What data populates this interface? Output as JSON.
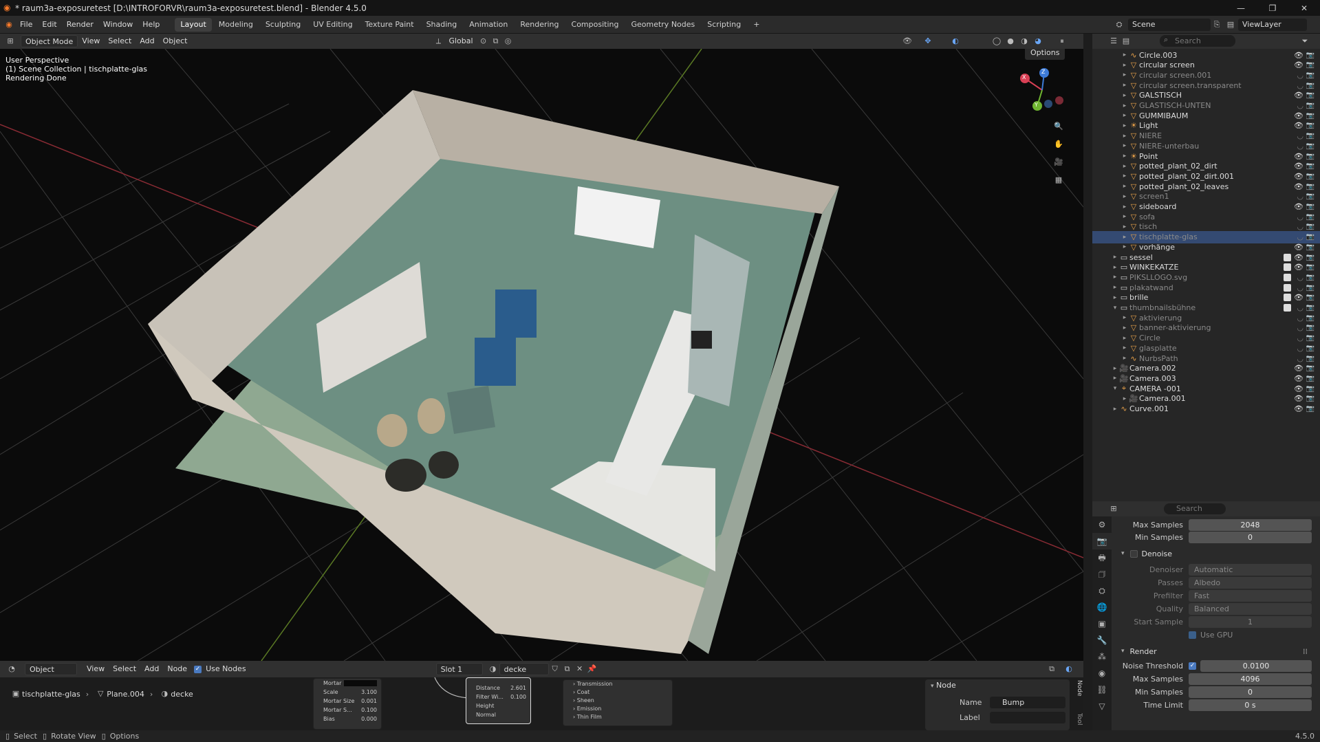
{
  "window": {
    "title": "* raum3a-exposuretest [D:\\INTROFORVR\\raum3a-exposuretest.blend] - Blender 4.5.0"
  },
  "topbar": {
    "menus": [
      "File",
      "Edit",
      "Render",
      "Window",
      "Help"
    ],
    "workspaces": [
      "Layout",
      "Modeling",
      "Sculpting",
      "UV Editing",
      "Texture Paint",
      "Shading",
      "Animation",
      "Rendering",
      "Compositing",
      "Geometry Nodes",
      "Scripting"
    ],
    "active_workspace": "Layout",
    "add_tab": "+",
    "scene": "Scene",
    "view_layer": "ViewLayer"
  },
  "viewport": {
    "mode": "Object Mode",
    "menus": [
      "View",
      "Select",
      "Add",
      "Object"
    ],
    "transform": "Global",
    "options_label": "Options",
    "overlay_lines": [
      "User Perspective",
      "(1) Scene Collection | tischplatte-glas",
      "Rendering Done"
    ],
    "gizmo": {
      "x": "X",
      "y": "Y",
      "z": "Z"
    }
  },
  "outliner": {
    "search_placeholder": "Search",
    "rows": [
      {
        "name": "Circle.003",
        "indent": 2,
        "icon": "curve-icon",
        "vis": true,
        "chk": false,
        "dim": false,
        "sel": false,
        "tri": "▸"
      },
      {
        "name": "circular screen",
        "indent": 2,
        "icon": "mesh-icon",
        "vis": true,
        "chk": false,
        "dim": false,
        "sel": false,
        "tri": "▸"
      },
      {
        "name": "circular screen.001",
        "indent": 2,
        "icon": "mesh-icon",
        "vis": false,
        "chk": false,
        "dim": true,
        "sel": false,
        "tri": "▸"
      },
      {
        "name": "circular screen.transparent",
        "indent": 2,
        "icon": "mesh-icon",
        "vis": false,
        "chk": false,
        "dim": true,
        "sel": false,
        "tri": "▸"
      },
      {
        "name": "GALSTISCH",
        "indent": 2,
        "icon": "mesh-icon",
        "vis": true,
        "chk": false,
        "dim": false,
        "sel": false,
        "tri": "▸"
      },
      {
        "name": "GLASTISCH-UNTEN",
        "indent": 2,
        "icon": "mesh-icon",
        "vis": false,
        "chk": false,
        "dim": true,
        "sel": false,
        "tri": "▸"
      },
      {
        "name": "GUMMIBAUM",
        "indent": 2,
        "icon": "mesh-icon",
        "vis": true,
        "chk": false,
        "dim": false,
        "sel": false,
        "tri": "▸"
      },
      {
        "name": "Light",
        "indent": 2,
        "icon": "light-icon",
        "vis": true,
        "chk": false,
        "dim": false,
        "sel": false,
        "tri": "▸"
      },
      {
        "name": "NIERE",
        "indent": 2,
        "icon": "mesh-icon",
        "vis": false,
        "chk": false,
        "dim": true,
        "sel": false,
        "tri": "▸"
      },
      {
        "name": "NIERE-unterbau",
        "indent": 2,
        "icon": "mesh-icon",
        "vis": false,
        "chk": false,
        "dim": true,
        "sel": false,
        "tri": "▸"
      },
      {
        "name": "Point",
        "indent": 2,
        "icon": "light-icon",
        "vis": true,
        "chk": false,
        "dim": false,
        "sel": false,
        "tri": "▸"
      },
      {
        "name": "potted_plant_02_dirt",
        "indent": 2,
        "icon": "mesh-icon",
        "vis": true,
        "chk": false,
        "dim": false,
        "sel": false,
        "tri": "▸"
      },
      {
        "name": "potted_plant_02_dirt.001",
        "indent": 2,
        "icon": "mesh-icon",
        "vis": true,
        "chk": false,
        "dim": false,
        "sel": false,
        "tri": "▸"
      },
      {
        "name": "potted_plant_02_leaves",
        "indent": 2,
        "icon": "mesh-icon",
        "vis": true,
        "chk": false,
        "dim": false,
        "sel": false,
        "tri": "▸"
      },
      {
        "name": "screen1",
        "indent": 2,
        "icon": "mesh-icon",
        "vis": false,
        "chk": false,
        "dim": true,
        "sel": false,
        "tri": "▸"
      },
      {
        "name": "sideboard",
        "indent": 2,
        "icon": "mesh-icon",
        "vis": true,
        "chk": false,
        "dim": false,
        "sel": false,
        "tri": "▸"
      },
      {
        "name": "sofa",
        "indent": 2,
        "icon": "mesh-icon",
        "vis": false,
        "chk": false,
        "dim": true,
        "sel": false,
        "tri": "▸"
      },
      {
        "name": "tisch",
        "indent": 2,
        "icon": "mesh-icon",
        "vis": false,
        "chk": false,
        "dim": true,
        "sel": false,
        "tri": "▸"
      },
      {
        "name": "tischplatte-glas",
        "indent": 2,
        "icon": "mesh-icon",
        "vis": false,
        "chk": false,
        "dim": true,
        "sel": true,
        "tri": "▸"
      },
      {
        "name": "vorhänge",
        "indent": 2,
        "icon": "mesh-icon",
        "vis": true,
        "chk": false,
        "dim": false,
        "sel": false,
        "tri": "▸"
      },
      {
        "name": "sessel",
        "indent": 1,
        "icon": "collection-icon",
        "vis": true,
        "chk": true,
        "dim": false,
        "sel": false,
        "tri": "▸"
      },
      {
        "name": "WINKEKATZE",
        "indent": 1,
        "icon": "collection-icon",
        "vis": true,
        "chk": true,
        "dim": false,
        "sel": false,
        "tri": "▸"
      },
      {
        "name": "PIKSLLOGO.svg",
        "indent": 1,
        "icon": "collection-icon",
        "vis": false,
        "chk": true,
        "dim": true,
        "sel": false,
        "tri": "▸"
      },
      {
        "name": "plakatwand",
        "indent": 1,
        "icon": "collection-icon",
        "vis": false,
        "chk": true,
        "dim": true,
        "sel": false,
        "tri": "▸"
      },
      {
        "name": "brille",
        "indent": 1,
        "icon": "collection-icon",
        "vis": true,
        "chk": true,
        "dim": false,
        "sel": false,
        "tri": "▸"
      },
      {
        "name": "thumbnailsbühne",
        "indent": 1,
        "icon": "collection-icon",
        "vis": false,
        "chk": true,
        "dim": true,
        "sel": false,
        "tri": "▾"
      },
      {
        "name": "aktivierung",
        "indent": 2,
        "icon": "mesh-icon",
        "vis": false,
        "chk": false,
        "dim": true,
        "sel": false,
        "tri": "▸"
      },
      {
        "name": "banner-aktivierung",
        "indent": 2,
        "icon": "mesh-icon",
        "vis": false,
        "chk": false,
        "dim": true,
        "sel": false,
        "tri": "▸"
      },
      {
        "name": "Circle",
        "indent": 2,
        "icon": "mesh-icon",
        "vis": false,
        "chk": false,
        "dim": true,
        "sel": false,
        "tri": "▸"
      },
      {
        "name": "glasplatte",
        "indent": 2,
        "icon": "mesh-icon",
        "vis": false,
        "chk": false,
        "dim": true,
        "sel": false,
        "tri": "▸"
      },
      {
        "name": "NurbsPath",
        "indent": 2,
        "icon": "curve-icon",
        "vis": false,
        "chk": false,
        "dim": true,
        "sel": false,
        "tri": "▸"
      },
      {
        "name": "Camera.002",
        "indent": 1,
        "icon": "camera-icon",
        "vis": true,
        "chk": false,
        "dim": false,
        "sel": false,
        "tri": "▸"
      },
      {
        "name": "Camera.003",
        "indent": 1,
        "icon": "camera-icon",
        "vis": true,
        "chk": false,
        "dim": false,
        "sel": false,
        "tri": "▸"
      },
      {
        "name": "CAMERA -001",
        "indent": 1,
        "icon": "empty-icon",
        "vis": true,
        "chk": false,
        "dim": false,
        "sel": false,
        "tri": "▾"
      },
      {
        "name": "Camera.001",
        "indent": 2,
        "icon": "camera-icon",
        "vis": true,
        "chk": false,
        "dim": false,
        "sel": false,
        "tri": "▸"
      },
      {
        "name": "Curve.001",
        "indent": 1,
        "icon": "curve-icon",
        "vis": true,
        "chk": false,
        "dim": false,
        "sel": false,
        "tri": "▸"
      }
    ]
  },
  "properties": {
    "search_placeholder": "Search",
    "max_samples_top": {
      "label": "Max Samples",
      "value": "2048"
    },
    "min_samples_top": {
      "label": "Min Samples",
      "value": "0"
    },
    "denoise": {
      "title": "Denoise",
      "denoiser": {
        "label": "Denoiser",
        "value": "Automatic"
      },
      "passes": {
        "label": "Passes",
        "value": "Albedo"
      },
      "prefilter": {
        "label": "Prefilter",
        "value": "Fast"
      },
      "quality": {
        "label": "Quality",
        "value": "Balanced"
      },
      "start_sample": {
        "label": "Start Sample",
        "value": "1"
      },
      "use_gpu": "Use GPU"
    },
    "render": {
      "title": "Render",
      "noise_threshold": {
        "label": "Noise Threshold",
        "value": "0.0100"
      },
      "max_samples": {
        "label": "Max Samples",
        "value": "4096"
      },
      "min_samples": {
        "label": "Min Samples",
        "value": "0"
      },
      "time_limit": {
        "label": "Time Limit",
        "value": "0 s"
      }
    }
  },
  "node_editor": {
    "editor_type": "Object",
    "menus": [
      "View",
      "Select",
      "Add",
      "Node"
    ],
    "use_nodes": "Use Nodes",
    "slot": "Slot 1",
    "material": "decke",
    "breadcrumb": [
      "tischplatte-glas",
      "Plane.004",
      "decke"
    ],
    "node_a": [
      {
        "label": "Mortar",
        "value": ""
      },
      {
        "label": "Scale",
        "value": "3.100"
      },
      {
        "label": "Mortar Size",
        "value": "0.001"
      },
      {
        "label": "Mortar S...",
        "value": "0.100"
      },
      {
        "label": "Bias",
        "value": "0.000"
      }
    ],
    "node_b": [
      {
        "label": "Distance",
        "value": "2.601"
      },
      {
        "label": "Filter Wi...",
        "value": "0.100"
      },
      {
        "label": "Height",
        "value": ""
      },
      {
        "label": "Normal",
        "value": ""
      }
    ],
    "node_c": [
      "Transmission",
      "Coat",
      "Sheen",
      "Emission",
      "Thin Film"
    ],
    "sidebar": {
      "section": "Node",
      "name_label": "Name",
      "name_value": "Bump",
      "label_label": "Label",
      "label_value": "",
      "tabs": [
        "Node",
        "Tool"
      ]
    }
  },
  "statusbar": {
    "items": [
      "Select",
      "Rotate View",
      "Options"
    ],
    "version": "4.5.0"
  }
}
